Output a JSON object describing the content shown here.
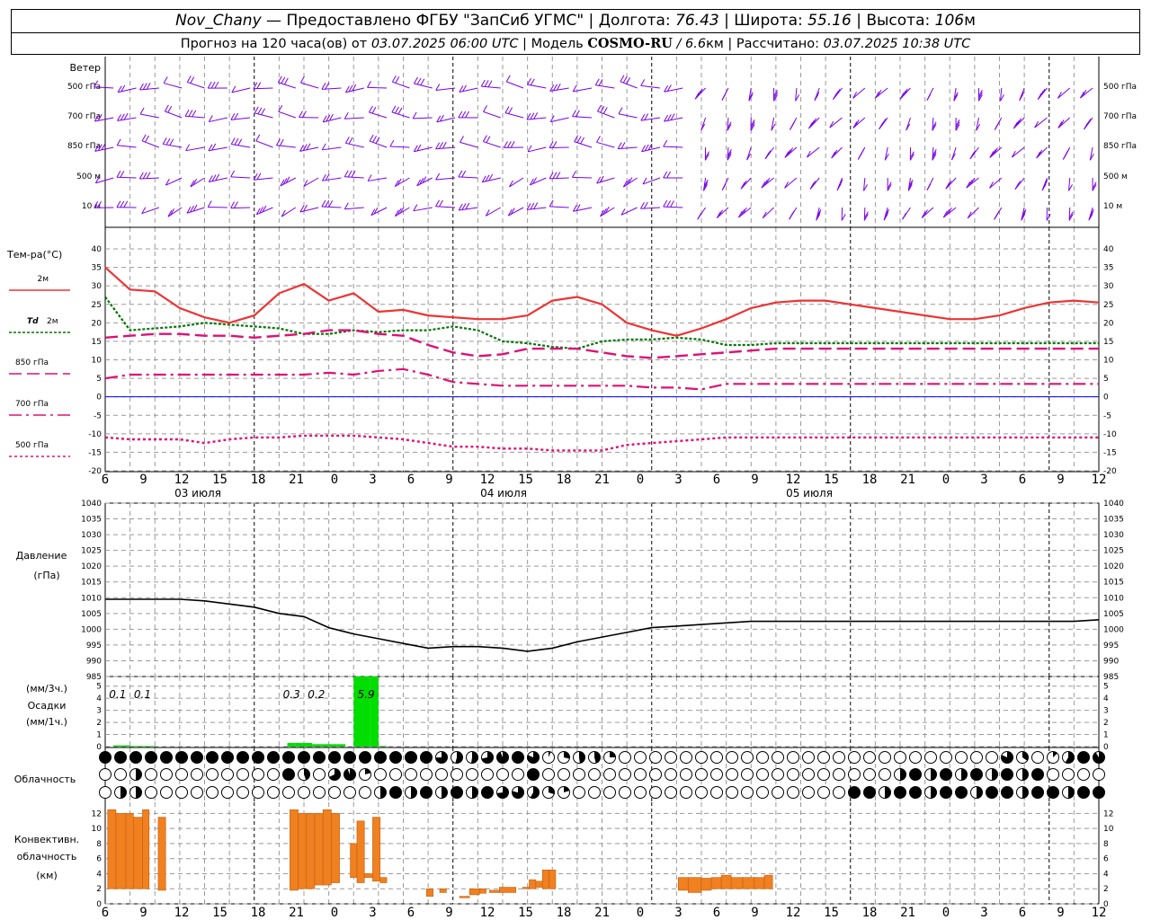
{
  "header": {
    "station": "Nov_Chany",
    "dash": " — ",
    "provider": "Предоставлено ФГБУ \"ЗапСиб УГМС\"",
    "lon_label": "Долгота:",
    "lon_value": "76.43",
    "lat_label": "Широта:",
    "lat_value": "55.16",
    "alt_label": "Высота:",
    "alt_value": "106",
    "alt_unit": "м",
    "forecast_prefix": "Прогноз на 120 часа(ов) от",
    "forecast_time": "03.07.2025 06:00 UTC",
    "model_label": "Модель",
    "model_name": "COSMO-RU",
    "model_res": "/ 6.6",
    "model_res_unit": "км",
    "calc_label": "Рассчитано:",
    "calc_time": "03.07.2025 10:38 UTC"
  },
  "colors": {
    "grid": "#999999",
    "wind": "#7a00e6",
    "t2m": "#ee3333",
    "td2m": "#007700",
    "t850": "#dd1177",
    "t700": "#dd1177",
    "t500": "#dd1177",
    "zero_line": "#0000ff",
    "pressure": "#000000",
    "precip": "#00dd00",
    "convective": "#f08020"
  },
  "x_axis": {
    "hours": [
      "6",
      "9",
      "12",
      "15",
      "18",
      "21",
      "0",
      "3",
      "6",
      "9",
      "12",
      "15",
      "18",
      "21",
      "0",
      "3",
      "6",
      "9",
      "12",
      "15",
      "18",
      "21",
      "0",
      "3",
      "6",
      "9",
      "12"
    ],
    "day_labels": [
      "03 июля",
      "04 июля",
      "05 июля"
    ]
  },
  "chart_data": [
    {
      "type": "wind_barbs",
      "title": "Ветер",
      "levels": [
        "500 гПа",
        "700 гПа",
        "850 гПа",
        "500 м",
        "10 м"
      ],
      "note": "Wind barbs every ~2h for 120h; directions approximate"
    },
    {
      "type": "line",
      "title": "Тем-ра(°C)",
      "ylim": [
        -20,
        40
      ],
      "yticks": [
        "40",
        "35",
        "30",
        "25",
        "20",
        "15",
        "10",
        "5",
        "0",
        "-5",
        "-10",
        "-15",
        "-20"
      ],
      "x_hours_from_start": [
        0,
        3,
        6,
        9,
        12,
        15,
        18,
        21,
        24,
        27,
        30,
        33,
        36,
        39,
        42,
        45,
        48,
        51,
        54,
        57,
        60,
        63,
        66,
        69,
        72,
        75,
        78,
        81,
        84,
        87,
        90,
        93,
        96,
        99,
        102,
        105,
        108,
        111,
        114,
        117,
        120
      ],
      "series": [
        {
          "name": "2м",
          "legend": "2м",
          "style": "solid",
          "values": [
            35,
            29,
            28.5,
            24,
            21.5,
            20,
            22,
            28,
            30.5,
            26,
            28,
            23,
            23.5,
            22,
            21.5,
            21,
            21,
            22,
            26,
            27,
            25,
            20,
            18,
            16.5,
            18.5,
            21,
            24,
            25.5,
            26,
            26,
            25,
            24,
            23,
            22,
            21,
            21,
            22,
            24,
            25.5,
            26,
            25.5
          ]
        },
        {
          "name": "Td 2м",
          "legend_prefix": "Td",
          "legend": "2м",
          "style": "dotted",
          "values": [
            27,
            18,
            18.5,
            19,
            20,
            19.5,
            19,
            18.5,
            17,
            17,
            18,
            17.5,
            18,
            18,
            19,
            18,
            15,
            14.5,
            13.5,
            13,
            15,
            15.5,
            15.5,
            16,
            15.5,
            14,
            14,
            14.5,
            14.5,
            14.5,
            14.5,
            14.5,
            14.5,
            14.5,
            14.5,
            14.5,
            14.5,
            14.5,
            14.5,
            14.5,
            14.5
          ]
        },
        {
          "name": "850 гПа",
          "legend": "850 гПа",
          "style": "dash",
          "values": [
            16,
            16.5,
            17,
            17,
            16.5,
            16.5,
            16,
            16.5,
            17,
            18,
            18,
            17,
            16.5,
            14,
            12,
            11,
            11.5,
            13,
            13,
            13,
            12,
            11,
            10.5,
            11,
            11.5,
            12,
            12.5,
            13,
            13,
            13,
            13,
            13,
            13,
            13,
            13,
            13,
            13,
            13,
            13,
            13,
            13
          ]
        },
        {
          "name": "700 гПа",
          "legend": "700 гПа",
          "style": "dashdot",
          "values": [
            5,
            6,
            6,
            6,
            6,
            6,
            6,
            6,
            6,
            6.5,
            6,
            7,
            7.5,
            6,
            4,
            3.5,
            3,
            3,
            3,
            3,
            3,
            3,
            2.5,
            2.5,
            2,
            3.5,
            3.5,
            3.5,
            3.5,
            3.5,
            3.5,
            3.5,
            3.5,
            3.5,
            3.5,
            3.5,
            3.5,
            3.5,
            3.5,
            3.5,
            3.5
          ]
        },
        {
          "name": "500 гПа",
          "legend": "500 гПа",
          "style": "dot",
          "values": [
            -11,
            -11.5,
            -11.5,
            -11.5,
            -12.5,
            -11.5,
            -11,
            -11,
            -10.5,
            -10.5,
            -10.5,
            -11,
            -11.5,
            -12.5,
            -13.5,
            -13.5,
            -14,
            -14,
            -14.5,
            -14.5,
            -14.5,
            -13,
            -12.5,
            -12,
            -11.5,
            -11,
            -11,
            -11,
            -11,
            -11,
            -11,
            -11,
            -11,
            -11,
            -11,
            -11,
            -11,
            -11,
            -11,
            -11,
            -11
          ]
        }
      ]
    },
    {
      "type": "line",
      "title": "Давление",
      "unit": "(гПа)",
      "ylim": [
        985,
        1040
      ],
      "yticks": [
        "1040",
        "1035",
        "1030",
        "1025",
        "1020",
        "1015",
        "1010",
        "1005",
        "1000",
        "995",
        "990",
        "985"
      ],
      "series": [
        {
          "name": "Давление",
          "values": [
            1009.5,
            1009.5,
            1009.5,
            1009.5,
            1009,
            1008,
            1007,
            1005,
            1004,
            1000.5,
            998.5,
            997,
            995.5,
            994,
            994.5,
            994.5,
            994,
            993,
            994,
            996,
            997.5,
            999,
            1000.5,
            1001,
            1001.5,
            1002,
            1002.5,
            1002.5,
            1002.5,
            1002.5,
            1002.5,
            1002.5,
            1002.5,
            1002.5,
            1002.5,
            1002.5,
            1002.5,
            1002.5,
            1002.5,
            1002.5,
            1003
          ]
        }
      ]
    },
    {
      "type": "bar",
      "title": "Осадки",
      "units": [
        "(мм/3ч.)",
        "(мм/1ч.)"
      ],
      "ylim": [
        0,
        5.5
      ],
      "yticks": [
        "5",
        "4",
        "3",
        "2",
        "1",
        "0"
      ],
      "x_hours_from_start": [
        1,
        2,
        3,
        4,
        5,
        22,
        23,
        24,
        25,
        26,
        27,
        28,
        30,
        31,
        32,
        33,
        34,
        35
      ],
      "values": [
        0.1,
        0.1,
        0.05,
        0.05,
        0.05,
        0.3,
        0.3,
        0.3,
        0.2,
        0.2,
        0.2,
        0.2,
        5.9,
        5.9,
        5.9,
        0.05,
        0,
        0
      ],
      "labels": [
        {
          "hour": 1.5,
          "text": "0.1"
        },
        {
          "hour": 4.5,
          "text": "0.1"
        },
        {
          "hour": 22.5,
          "text": "0.3"
        },
        {
          "hour": 25.5,
          "text": "0.2"
        },
        {
          "hour": 31.5,
          "text": "5.9"
        }
      ]
    },
    {
      "type": "cloud_cover_symbols",
      "title": "Облачность",
      "rows": 3
    },
    {
      "type": "range_bar",
      "title": "Конвективн.",
      "title2": "облачность",
      "unit": "(км)",
      "ylim": [
        0,
        13
      ],
      "yticks": [
        "12",
        "10",
        "8",
        "6",
        "4",
        "2",
        "0"
      ],
      "bars": [
        {
          "h0": 0.3,
          "h1": 1.3,
          "lo": 2.0,
          "hi": 12.5
        },
        {
          "h0": 1.3,
          "h1": 2.5,
          "lo": 2.0,
          "hi": 12.0
        },
        {
          "h0": 2.5,
          "h1": 3.4,
          "lo": 2.0,
          "hi": 12.0
        },
        {
          "h0": 3.4,
          "h1": 4.5,
          "lo": 2.0,
          "hi": 11.5
        },
        {
          "h0": 4.5,
          "h1": 5.3,
          "lo": 2.0,
          "hi": 12.5
        },
        {
          "h0": 6.4,
          "h1": 7.3,
          "lo": 1.8,
          "hi": 11.5
        },
        {
          "h0": 22.3,
          "h1": 23.3,
          "lo": 1.8,
          "hi": 12.5
        },
        {
          "h0": 23.3,
          "h1": 24.3,
          "lo": 2.0,
          "hi": 12.0
        },
        {
          "h0": 24.3,
          "h1": 25.3,
          "lo": 2.0,
          "hi": 12.0
        },
        {
          "h0": 25.3,
          "h1": 26.3,
          "lo": 2.5,
          "hi": 12.0
        },
        {
          "h0": 26.3,
          "h1": 27.3,
          "lo": 2.5,
          "hi": 12.5
        },
        {
          "h0": 27.3,
          "h1": 28.3,
          "lo": 2.8,
          "hi": 12.0
        },
        {
          "h0": 29.6,
          "h1": 30.4,
          "lo": 3.5,
          "hi": 8.0
        },
        {
          "h0": 30.4,
          "h1": 31.3,
          "lo": 2.8,
          "hi": 11.0
        },
        {
          "h0": 31.3,
          "h1": 32.3,
          "lo": 3.5,
          "hi": 4.0
        },
        {
          "h0": 32.3,
          "h1": 33.2,
          "lo": 3.0,
          "hi": 11.5
        },
        {
          "h0": 33.2,
          "h1": 34.0,
          "lo": 2.8,
          "hi": 3.5
        },
        {
          "h0": 38.8,
          "h1": 39.6,
          "lo": 1.0,
          "hi": 2.0
        },
        {
          "h0": 40.4,
          "h1": 41.2,
          "lo": 1.5,
          "hi": 2.0
        },
        {
          "h0": 42.8,
          "h1": 44.0,
          "lo": 0.8,
          "hi": 1.0
        },
        {
          "h0": 44.0,
          "h1": 45.2,
          "lo": 1.2,
          "hi": 2.0
        },
        {
          "h0": 45.2,
          "h1": 46.0,
          "lo": 1.4,
          "hi": 2.0
        },
        {
          "h0": 46.4,
          "h1": 47.6,
          "lo": 1.5,
          "hi": 1.8
        },
        {
          "h0": 47.6,
          "h1": 49.6,
          "lo": 1.5,
          "hi": 2.2
        },
        {
          "h0": 50.4,
          "h1": 51.2,
          "lo": 2.0,
          "hi": 2.2
        },
        {
          "h0": 51.2,
          "h1": 52.0,
          "lo": 2.0,
          "hi": 3.2
        },
        {
          "h0": 52.0,
          "h1": 52.8,
          "lo": 2.2,
          "hi": 3.0
        },
        {
          "h0": 52.8,
          "h1": 53.6,
          "lo": 2.0,
          "hi": 4.5
        },
        {
          "h0": 53.6,
          "h1": 54.4,
          "lo": 2.0,
          "hi": 4.5
        },
        {
          "h0": 69.2,
          "h1": 70.4,
          "lo": 1.8,
          "hi": 3.5
        },
        {
          "h0": 70.4,
          "h1": 72.0,
          "lo": 1.5,
          "hi": 3.5
        },
        {
          "h0": 72.0,
          "h1": 73.2,
          "lo": 1.8,
          "hi": 3.4
        },
        {
          "h0": 73.2,
          "h1": 74.4,
          "lo": 2.0,
          "hi": 3.5
        },
        {
          "h0": 74.4,
          "h1": 75.6,
          "lo": 2.0,
          "hi": 3.8
        },
        {
          "h0": 75.6,
          "h1": 77.0,
          "lo": 2.0,
          "hi": 3.5
        },
        {
          "h0": 77.0,
          "h1": 78.4,
          "lo": 2.0,
          "hi": 3.5
        },
        {
          "h0": 78.4,
          "h1": 79.6,
          "lo": 2.0,
          "hi": 3.5
        },
        {
          "h0": 79.6,
          "h1": 80.6,
          "lo": 2.0,
          "hi": 3.8
        }
      ]
    }
  ]
}
